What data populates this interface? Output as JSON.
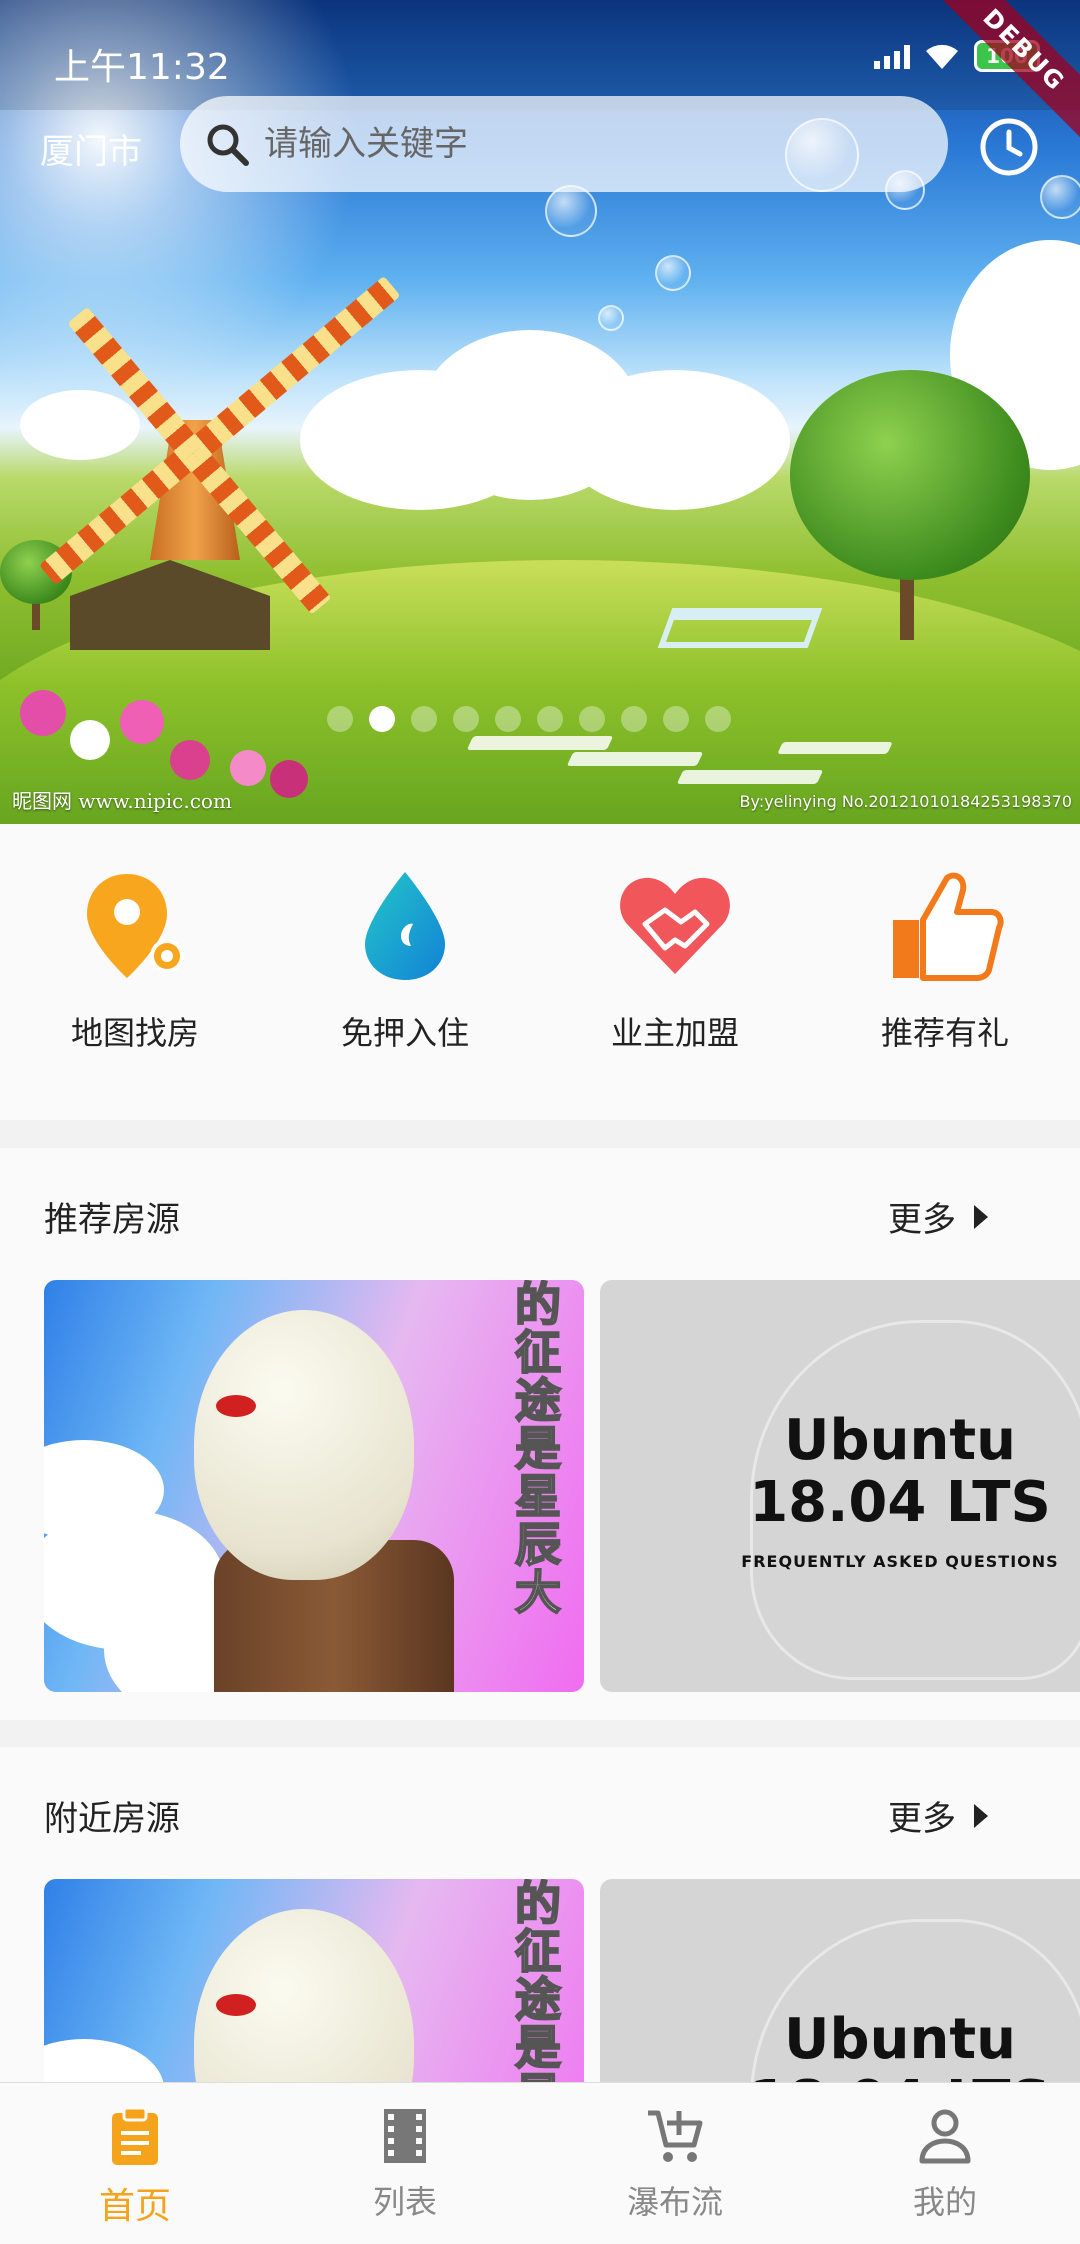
{
  "status_bar": {
    "time": "上午11:32",
    "battery": "100"
  },
  "debug_banner": "DEBUG",
  "header": {
    "city": "厦门市",
    "search_placeholder": "请输入关键字"
  },
  "banner": {
    "watermark_left": "昵图网 www.nipic.com",
    "watermark_right": "By:yelinying No.20121010184253198370",
    "dot_count": 10,
    "active_dot": 1
  },
  "shortcuts": [
    {
      "label": "地图找房",
      "icon": "map-pin-icon"
    },
    {
      "label": "免押入住",
      "icon": "water-drop-icon"
    },
    {
      "label": "业主加盟",
      "icon": "handshake-heart-icon"
    },
    {
      "label": "推荐有礼",
      "icon": "thumbs-up-icon"
    }
  ],
  "sections": [
    {
      "title": "推荐房源",
      "more": "更多"
    },
    {
      "title": "附近房源",
      "more": "更多"
    }
  ],
  "cards": {
    "vertical_text": "的征途是星辰大",
    "ubuntu_title": "Ubuntu",
    "ubuntu_version": "18.04 LTS",
    "ubuntu_subtitle": "FREQUENTLY ASKED QUESTIONS"
  },
  "bottom_nav": [
    {
      "label": "首页",
      "icon": "clipboard-icon",
      "active": true
    },
    {
      "label": "列表",
      "icon": "film-icon",
      "active": false
    },
    {
      "label": "瀑布流",
      "icon": "cart-add-icon",
      "active": false
    },
    {
      "label": "我的",
      "icon": "person-icon",
      "active": false
    }
  ],
  "colors": {
    "accent": "#f5a31a",
    "inactive": "#888888",
    "heart": "#f0565a",
    "drop": "#1aa9d6"
  }
}
